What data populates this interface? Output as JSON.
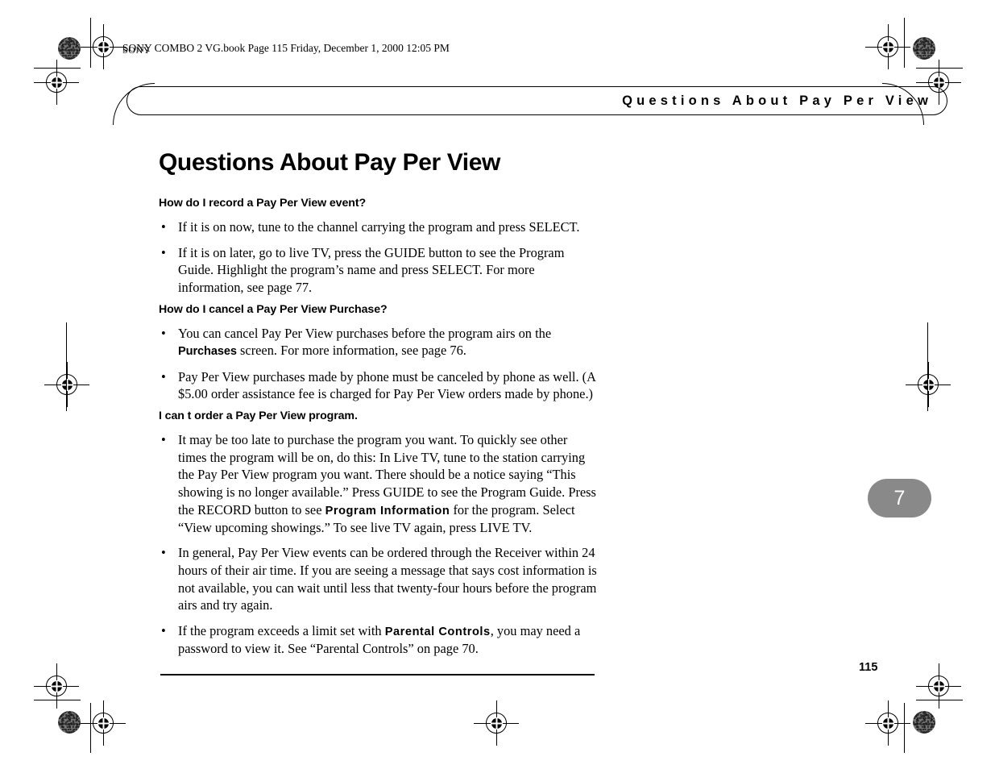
{
  "slug": {
    "text": "SONY COMBO 2 VG.book  Page 115  Friday, December 1, 2000  12:05 PM"
  },
  "header": {
    "running_title": "Questions About Pay Per View"
  },
  "prepress": {
    "brand_mark": "SONY"
  },
  "content": {
    "title": "Questions About Pay Per View",
    "sections": [
      {
        "heading": "How do I record a Pay Per View event?",
        "bullets": [
          {
            "bullet": "•",
            "parts": [
              {
                "style": "normal",
                "text": "If it is on now, tune to the channel carrying the program and press SELECT."
              }
            ]
          },
          {
            "bullet": "•",
            "parts": [
              {
                "style": "normal",
                "text": "If it is on later, go to live TV, press the GUIDE button to see the Program Guide. Highlight the program’s name and press SELECT. For more information, see page 77."
              }
            ]
          }
        ]
      },
      {
        "heading": "How do I cancel a Pay Per View Purchase?",
        "bullets": [
          {
            "bullet": "•",
            "parts": [
              {
                "style": "normal",
                "text": "You can cancel Pay Per View purchases before the program airs on the "
              },
              {
                "style": "bold",
                "text": "Purchases"
              },
              {
                "style": "normal",
                "text": " screen. For more information, see page 76."
              }
            ]
          },
          {
            "bullet": "•",
            "parts": [
              {
                "style": "normal",
                "text": "Pay Per View purchases made by phone must be canceled by phone as well. (A $5.00 order assistance fee is charged for Pay Per View orders made by phone.)"
              }
            ]
          }
        ]
      },
      {
        "heading": "I can t order a Pay Per View program.",
        "bullets": [
          {
            "bullet": "•",
            "parts": [
              {
                "style": "normal",
                "text": "It may be too late to purchase the program you want. To quickly see other times the program will be on, do this: In Live TV, tune to the station carrying the Pay Per View program you want. There should be a notice saying “This showing is no longer available.” Press GUIDE to see the Program Guide. Press the RECORD button to see "
              },
              {
                "style": "bold-wide",
                "text": "Program Information"
              },
              {
                "style": "normal",
                "text": " for the program. Select “View upcoming showings.” To see live TV again, press LIVE TV."
              }
            ]
          },
          {
            "bullet": "•",
            "parts": [
              {
                "style": "normal",
                "text": "In general, Pay Per View events can be ordered through the Receiver within 24 hours of their air time. If you are seeing a message that says cost information is not available, you can wait until less that twenty-four hours before the program airs and try again."
              }
            ]
          },
          {
            "bullet": "•",
            "parts": [
              {
                "style": "normal",
                "text": "If the program exceeds a limit set with "
              },
              {
                "style": "bold-wide",
                "text": "Parental Controls"
              },
              {
                "style": "normal",
                "text": ", you may need a password to view it. See “Parental Controls” on page 70."
              }
            ]
          }
        ]
      }
    ]
  },
  "chapter_tab": {
    "number": "7"
  },
  "footer": {
    "page_number": "115"
  },
  "colors": {
    "chapter_tab_gray": "#898989",
    "text_black": "#000000",
    "page_white": "#ffffff"
  }
}
